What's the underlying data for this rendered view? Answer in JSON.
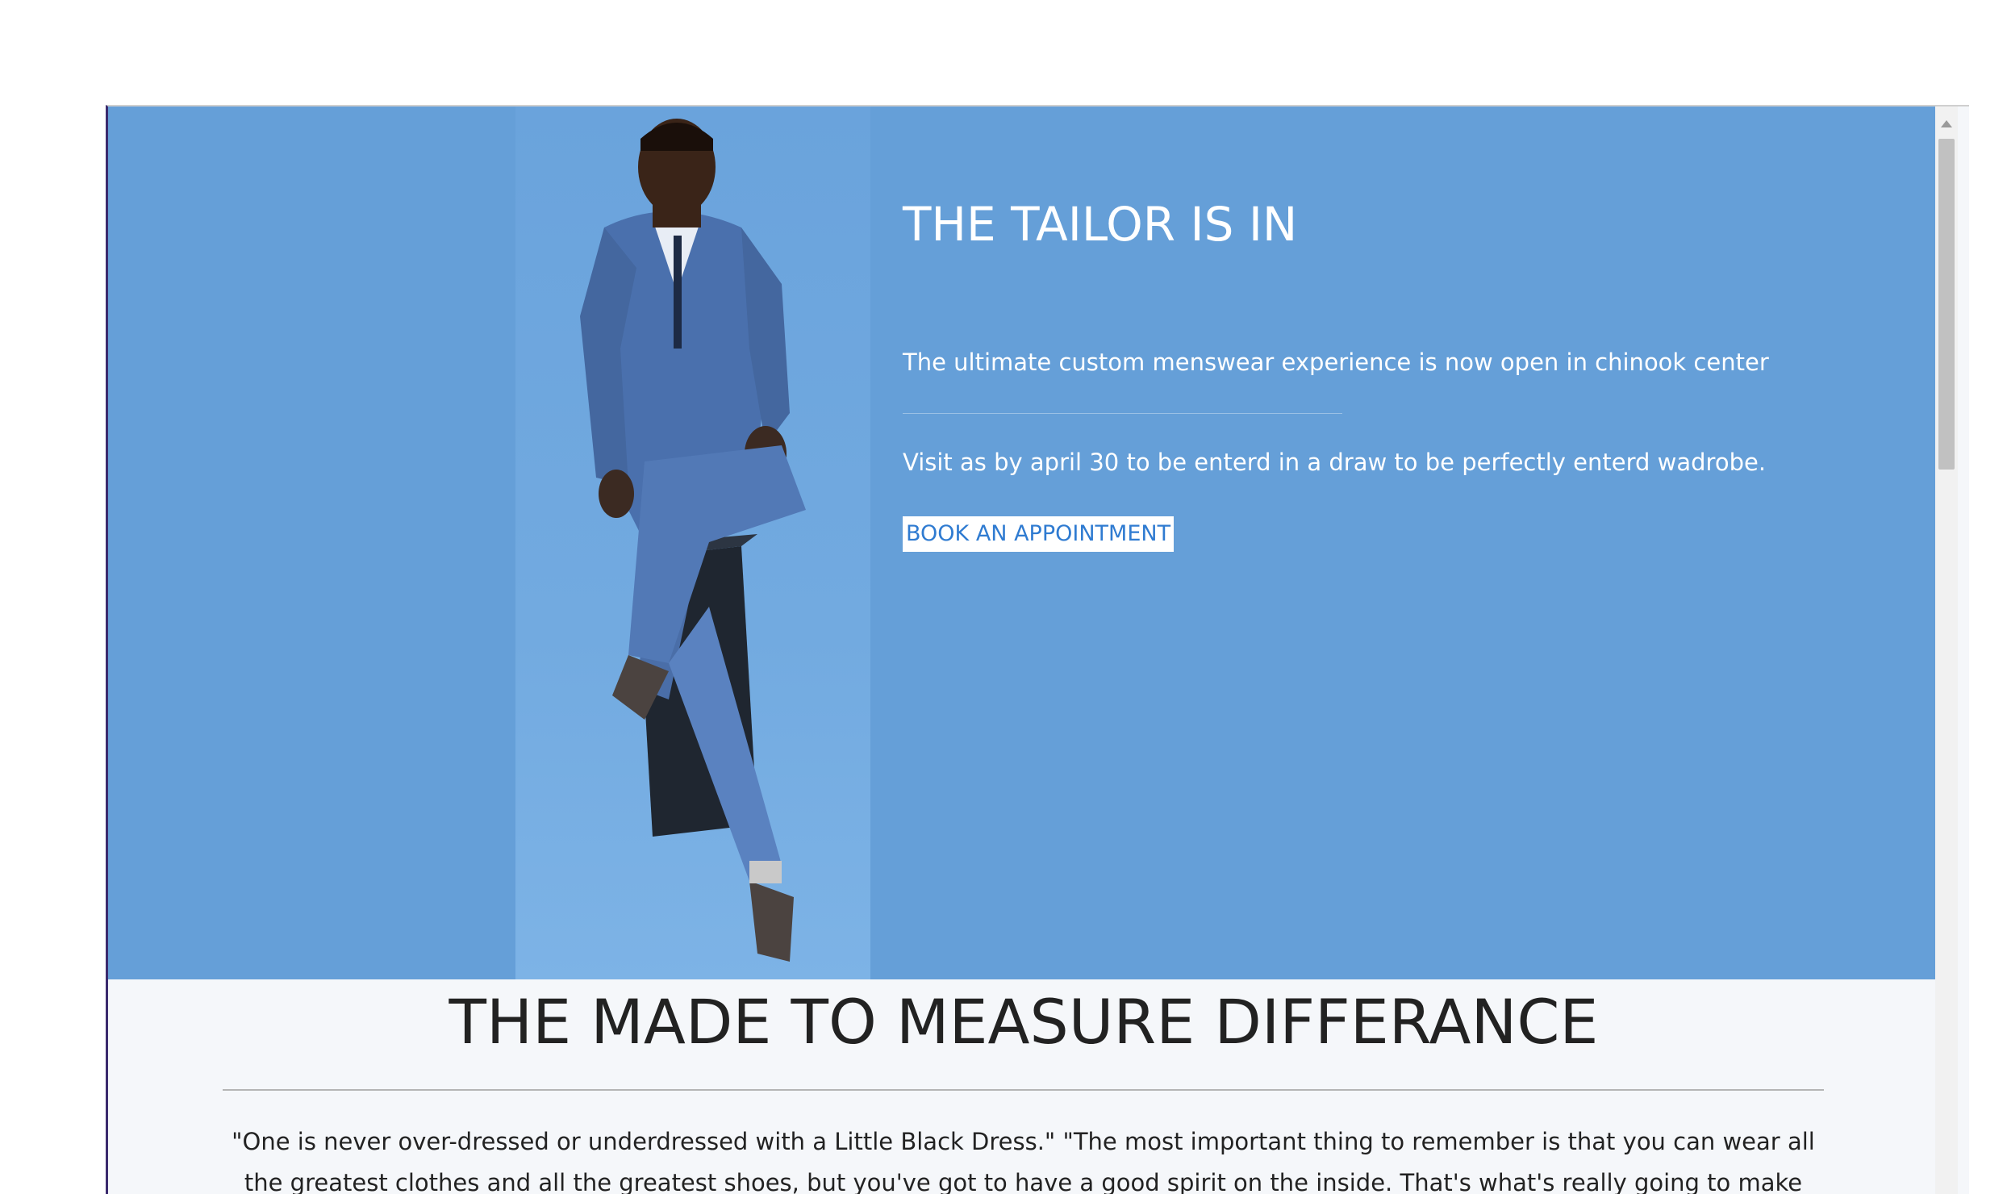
{
  "hero": {
    "title": "THE TAILOR IS IN",
    "subtitle": "The ultimate custom menswear experience is now open in chinook center",
    "visit_text": "Visit as by april 30 to be enterd in a draw to be perfectly enterd wadrobe.",
    "cta_label": "BOOK AN APPOINTMENT",
    "background_color": "#659fd8"
  },
  "section": {
    "title": "THE MADE TO MEASURE DIFFERANCE",
    "quote": "\"One is never over-dressed or underdressed with a Little Black Dress.\" \"The most important thing to remember is that you can wear all the greatest clothes and all the greatest shoes, but you've got to have a good spirit on the inside. That's what's really going to make you look like you're ready to rock the"
  },
  "icons": {
    "scroll_up": "scroll-up-arrow-icon"
  }
}
